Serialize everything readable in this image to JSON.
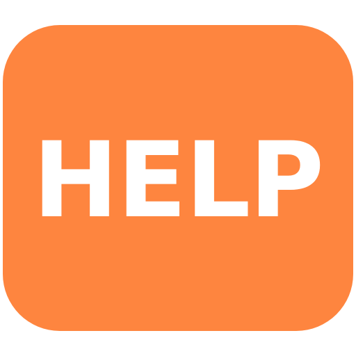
{
  "icon": {
    "name": "help-icon",
    "label": "HELP",
    "background_color": "#fe853f",
    "text_color": "#ffffff"
  }
}
